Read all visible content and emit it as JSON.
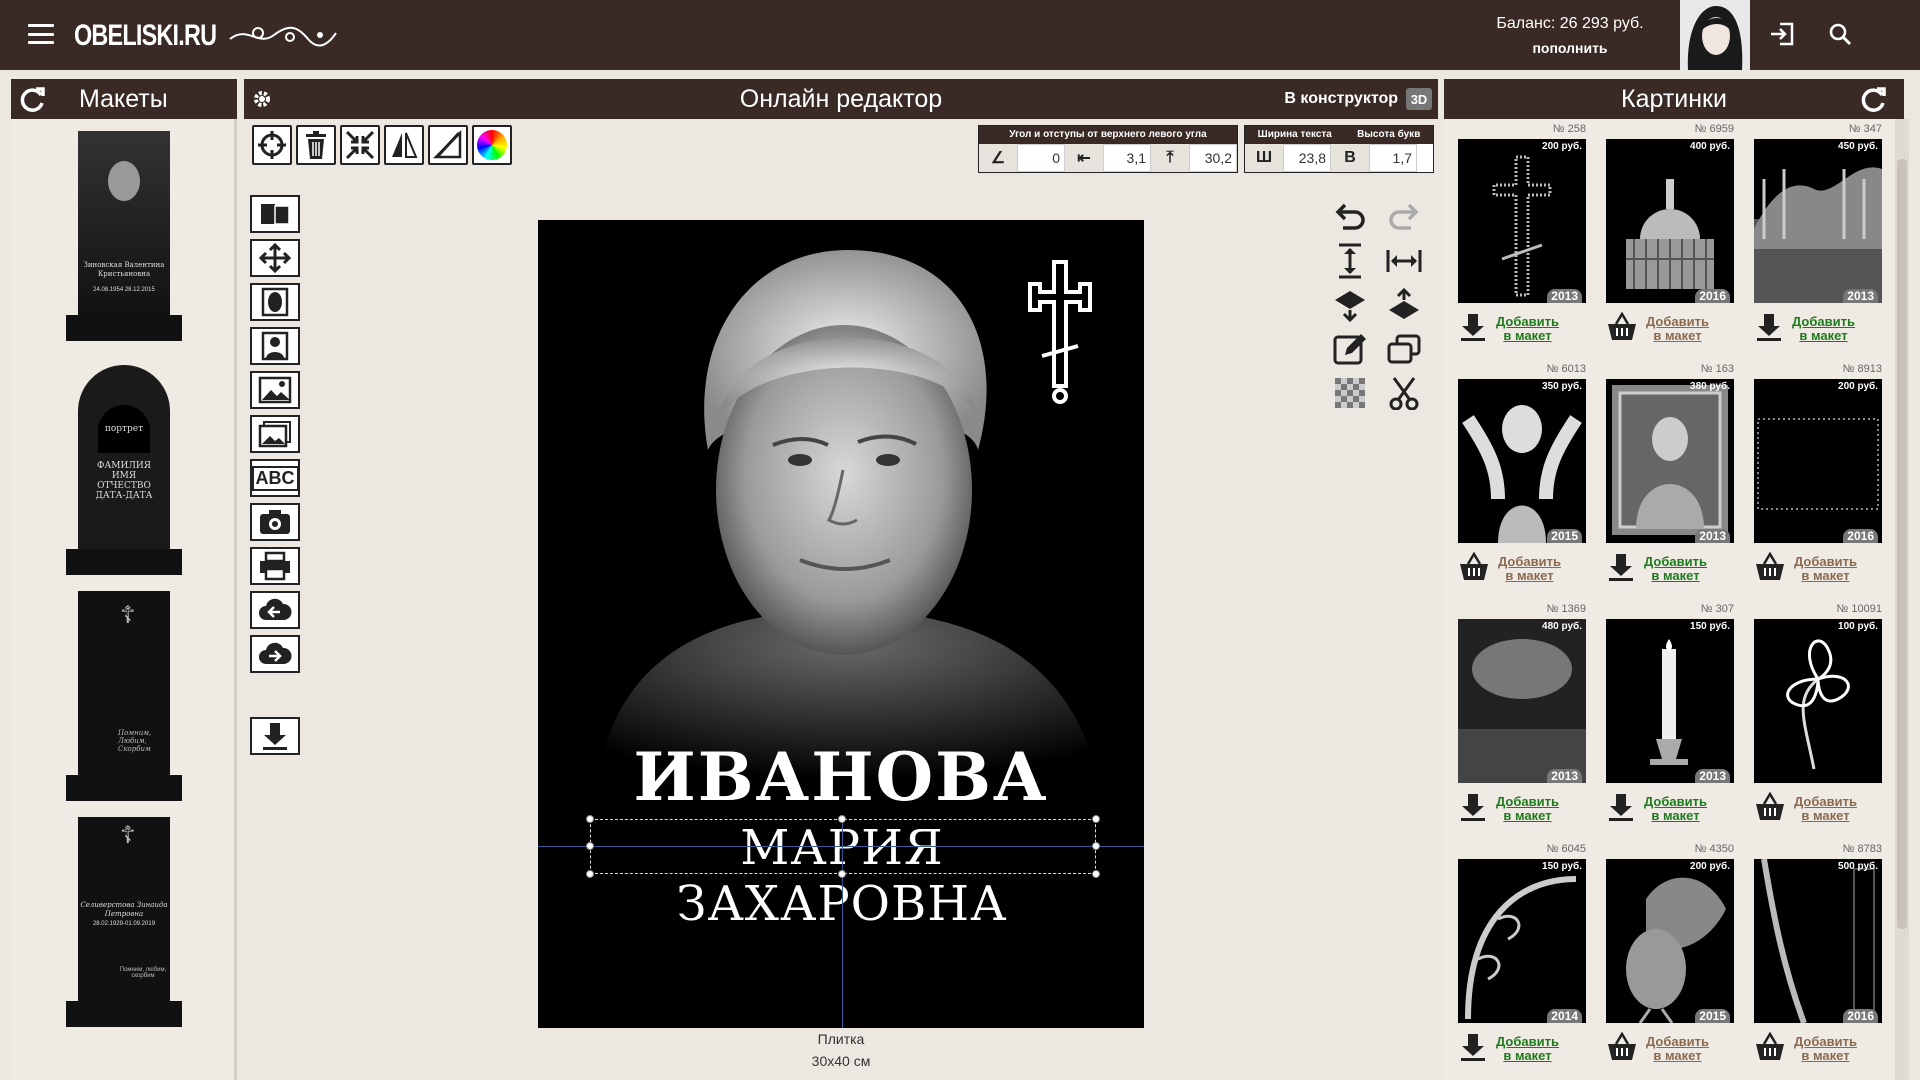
{
  "header": {
    "logo": "OBELISKI.RU",
    "balance": "Баланс: 26 293 руб.",
    "refill": "пополнить"
  },
  "panels": {
    "left_title": "Макеты",
    "center_title": "Онлайн редактор",
    "constructor_label": "В конструктор",
    "badge_3d": "3D",
    "right_title": "Картинки"
  },
  "fields": {
    "angle_caption": "Угол и отступы от верхнего левого угла",
    "angle": "0",
    "left": "3,1",
    "top": "30,2",
    "width_caption": "Ширина текста",
    "height_caption": "Высота букв",
    "width_label": "Ш",
    "width": "23,8",
    "height_label": "В",
    "height": "1,7"
  },
  "layouts": [
    {
      "name": "Зиновская Валентина Кристьяновна",
      "dates": "24.08.1954 28.12.2015"
    },
    {
      "portrait": "портрет",
      "lines": "ФАМИЛИЯ ИМЯ ОТЧЕСТВО ДАТА-ДАТА"
    },
    {
      "epitaph": "Помним, Любим, Скорбим"
    },
    {
      "name": "Селиверстова Зинаида Петровна",
      "dates": "28.02.1929-01.09.2019",
      "epitaph": "Помним, любим, скорбим"
    }
  ],
  "canvas": {
    "surname": "ИВАНОВА",
    "fullname": "МАРИЯ ЗАХАРОВНА",
    "material": "Плитка",
    "size": "30х40 см"
  },
  "images": [
    {
      "no": "№ 258",
      "price": "200 руб.",
      "year": "2013",
      "action": "download"
    },
    {
      "no": "№ 6959",
      "price": "400 руб.",
      "year": "2016",
      "action": "cart"
    },
    {
      "no": "№ 347",
      "price": "450 руб.",
      "year": "2013",
      "action": "download"
    },
    {
      "no": "№ 6013",
      "price": "350 руб.",
      "year": "2015",
      "action": "cart"
    },
    {
      "no": "№ 163",
      "price": "380 руб.",
      "year": "2013",
      "action": "download"
    },
    {
      "no": "№ 8913",
      "price": "200 руб.",
      "year": "2016",
      "action": "cart"
    },
    {
      "no": "№ 1369",
      "price": "480 руб.",
      "year": "2013",
      "action": "download"
    },
    {
      "no": "№ 307",
      "price": "150 руб.",
      "year": "2013",
      "action": "download"
    },
    {
      "no": "№ 10091",
      "price": "100 руб.",
      "year": "",
      "action": "cart"
    },
    {
      "no": "№ 6045",
      "price": "150 руб.",
      "year": "2014",
      "action": "download"
    },
    {
      "no": "№ 4350",
      "price": "200 руб.",
      "year": "2015",
      "action": "cart"
    },
    {
      "no": "№ 8783",
      "price": "500 руб.",
      "year": "2016",
      "action": "cart"
    }
  ],
  "add_line1": "Добавить",
  "add_line2": "в макет",
  "colors": {
    "brand": "#3a2a26",
    "bg": "#ece8e1",
    "green": "#1f7a1f"
  }
}
